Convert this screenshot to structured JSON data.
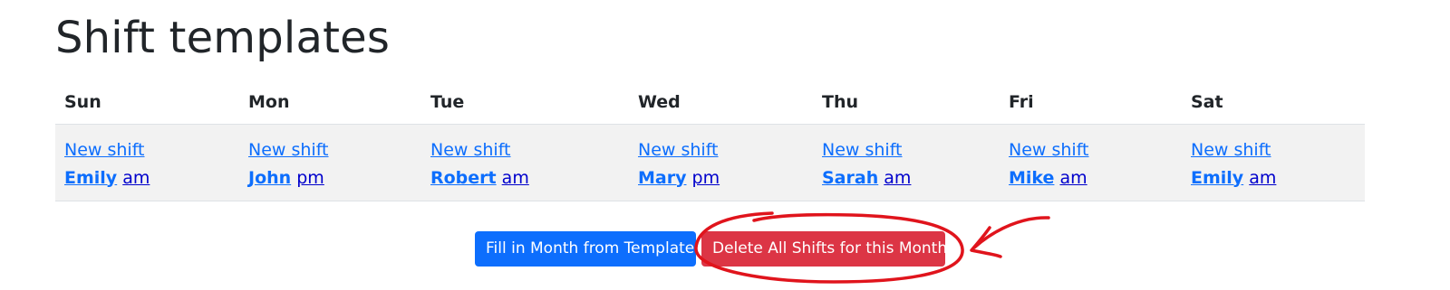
{
  "page": {
    "title": "Shift templates"
  },
  "table": {
    "days": [
      {
        "header": "Sun",
        "new_shift": "New shift",
        "name": "Emily",
        "period": "am"
      },
      {
        "header": "Mon",
        "new_shift": "New shift",
        "name": "John",
        "period": "pm"
      },
      {
        "header": "Tue",
        "new_shift": "New shift",
        "name": "Robert",
        "period": "am"
      },
      {
        "header": "Wed",
        "new_shift": "New shift",
        "name": "Mary",
        "period": "pm"
      },
      {
        "header": "Thu",
        "new_shift": "New shift",
        "name": "Sarah",
        "period": "am"
      },
      {
        "header": "Fri",
        "new_shift": "New shift",
        "name": "Mike",
        "period": "am"
      },
      {
        "header": "Sat",
        "new_shift": "New shift",
        "name": "Emily",
        "period": "am"
      }
    ]
  },
  "actions": {
    "fill_label": "Fill in Month from Template",
    "delete_label": "Delete All Shifts for this Month"
  },
  "colors": {
    "primary": "#0d6efd",
    "danger": "#dc3545",
    "row_background": "#f2f2f2",
    "annotation": "#e0141c"
  }
}
